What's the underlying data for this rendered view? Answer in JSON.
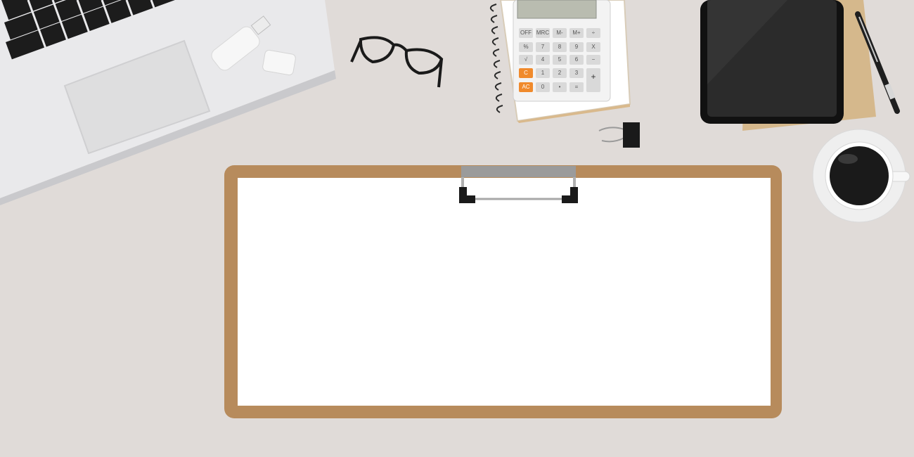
{
  "colors": {
    "desk": "#e0dbd8",
    "clipboard_board": "#b78b5c",
    "paper": "#ffffff",
    "laptop_body": "#e8e8ea",
    "keys": "#1c1c1c",
    "tablet": "#222222",
    "envelope": "#d5b88c",
    "coffee": "#1a1a1a",
    "calc_accent": "#f08a2c"
  },
  "calculator": {
    "keys_row1": [
      "OFF",
      "MRC",
      "M-",
      "M+",
      "÷"
    ],
    "keys_row2": [
      "%",
      "7",
      "8",
      "9",
      "X"
    ],
    "keys_row3": [
      "√",
      "4",
      "5",
      "6",
      "−"
    ],
    "keys_row4": [
      "C",
      "1",
      "2",
      "3",
      "+"
    ],
    "keys_row5": [
      "AC",
      "0",
      "•",
      "="
    ]
  },
  "icons": {
    "laptop": "laptop-icon",
    "usb": "usb-drive-icon",
    "glasses": "glasses-icon",
    "calculator": "calculator-icon",
    "tablet": "tablet-icon",
    "pen": "pen-icon",
    "coffee": "coffee-cup-icon",
    "binder_clip": "binder-clip-icon",
    "clipboard": "clipboard-icon"
  }
}
